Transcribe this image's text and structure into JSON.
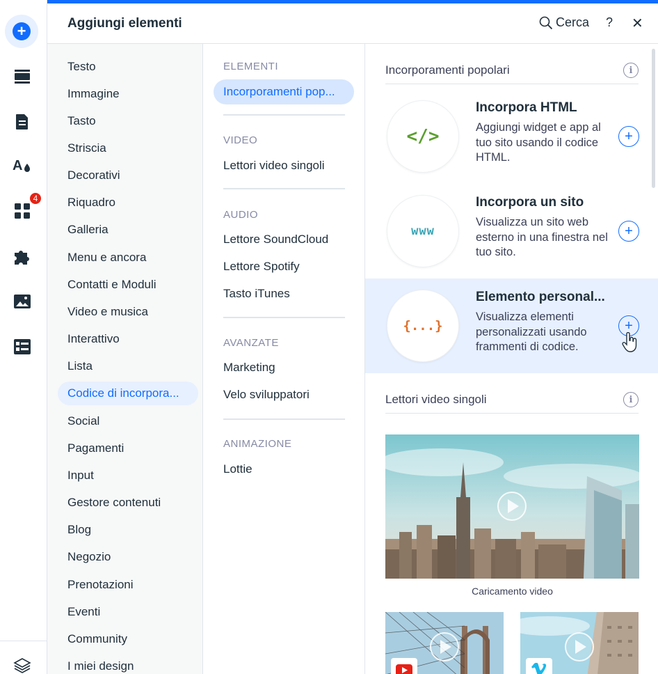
{
  "rail": {
    "icons": [
      "add-icon",
      "sections-icon",
      "pages-icon",
      "design-icon",
      "apps-icon",
      "business-icon",
      "media-icon",
      "cms-icon",
      "layers-icon"
    ],
    "apps_badge": "4"
  },
  "header": {
    "title": "Aggiungi elementi",
    "search_label": "Cerca",
    "help_label": "?",
    "close_label": "✕"
  },
  "categories": [
    "Testo",
    "Immagine",
    "Tasto",
    "Striscia",
    "Decorativi",
    "Riquadro",
    "Galleria",
    "Menu e ancora",
    "Contatti e Moduli",
    "Video e musica",
    "Interattivo",
    "Lista",
    "Codice di incorpora...",
    "Social",
    "Pagamenti",
    "Input",
    "Gestore contenuti",
    "Blog",
    "Negozio",
    "Prenotazioni",
    "Eventi",
    "Community",
    "I miei design"
  ],
  "active_category": "Codice di incorpora...",
  "subs": {
    "elementi": {
      "heading": "ELEMENTI",
      "items": [
        "Incorporamenti pop..."
      ]
    },
    "video": {
      "heading": "VIDEO",
      "items": [
        "Lettori video singoli"
      ]
    },
    "audio": {
      "heading": "AUDIO",
      "items": [
        "Lettore SoundCloud",
        "Lettore Spotify",
        "Tasto iTunes"
      ]
    },
    "avanzate": {
      "heading": "AVANZATE",
      "items": [
        "Marketing",
        "Velo sviluppatori"
      ]
    },
    "animazione": {
      "heading": "ANIMAZIONE",
      "items": [
        "Lottie"
      ]
    }
  },
  "content": {
    "popular": {
      "heading": "Incorporamenti popolari",
      "cards": [
        {
          "logo": "</>",
          "logo_color": "#5aa02c",
          "title": "Incorpora HTML",
          "desc": "Aggiungi widget e app al tuo sito usando il codice HTML."
        },
        {
          "logo": "www",
          "logo_color": "#3aa5b6",
          "title": "Incorpora un sito",
          "desc": "Visualizza un sito web esterno in una finestra nel tuo sito."
        },
        {
          "logo": "{...}",
          "logo_color": "#e1702c",
          "title": "Elemento personal...",
          "desc": "Visualizza elementi personalizzati usando frammenti di codice."
        }
      ]
    },
    "video": {
      "heading": "Lettori video singoli",
      "caption": "Caricamento video"
    }
  },
  "colors": {
    "accent": "#116dff",
    "hover_bg": "#e7f0ff"
  }
}
